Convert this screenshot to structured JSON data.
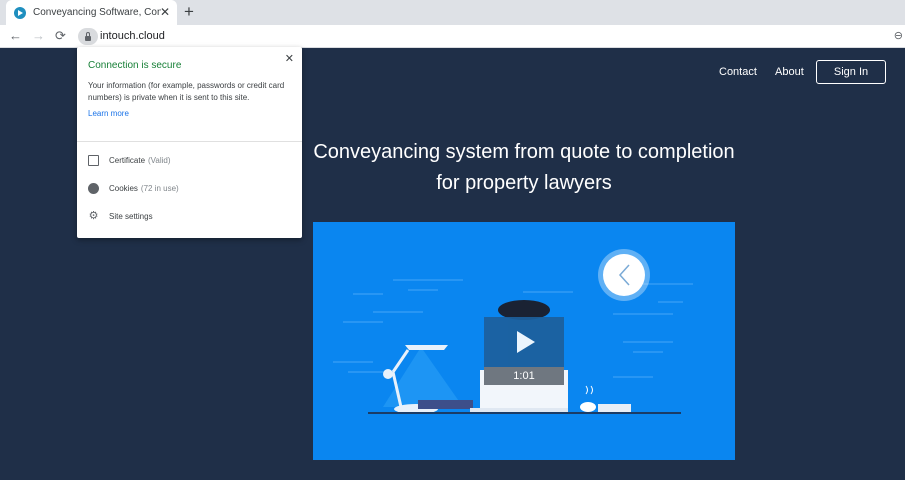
{
  "tab": {
    "title": "Conveyancing Software, Conveyancing",
    "close": "✕",
    "new_tab": "+"
  },
  "toolbar": {
    "back": "←",
    "forward": "→",
    "reload": "⟳",
    "url": "intouch.cloud"
  },
  "site_nav": {
    "contact": "Contact",
    "about": "About",
    "signin": "Sign In"
  },
  "hero": {
    "line1": "Conveyancing system from quote to completion",
    "line2": "for property lawyers"
  },
  "video": {
    "duration": "1:01"
  },
  "popup": {
    "close": "✕",
    "heading": "Connection is secure",
    "body": "Your information (for example, passwords or credit card numbers) is private when it is sent to this site.",
    "learn_more": "Learn more",
    "rows": [
      {
        "label": "Certificate",
        "detail": "(Valid)"
      },
      {
        "label": "Cookies",
        "detail": "(72 in use)"
      },
      {
        "label": "Site settings",
        "detail": ""
      }
    ]
  },
  "colors": {
    "page_bg": "#1f2f48",
    "video_bg": "#0a86f0",
    "secure_green": "#188038",
    "link_blue": "#1a73e8"
  }
}
